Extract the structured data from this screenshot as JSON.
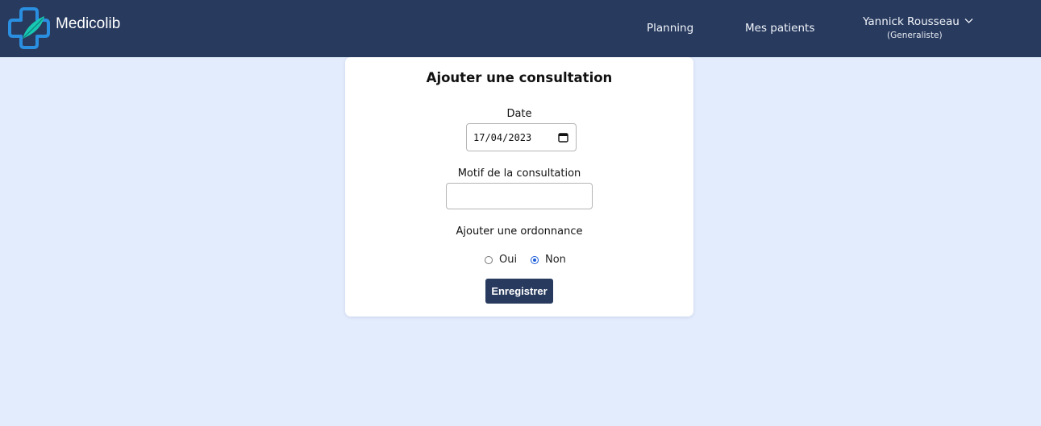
{
  "app": {
    "name": "Medicolib"
  },
  "nav": {
    "planning": "Planning",
    "patients": "Mes patients"
  },
  "user": {
    "name": "Yannick Rousseau",
    "role": "(Generaliste)"
  },
  "form": {
    "title": "Ajouter une consultation",
    "date_label": "Date",
    "date_value": "17/04/2023",
    "motif_label": "Motif de la consultation",
    "motif_value": "",
    "ordonnance_label": "Ajouter une ordonnance",
    "options": [
      {
        "label": "Oui",
        "checked": false
      },
      {
        "label": "Non",
        "checked": true
      }
    ],
    "submit": "Enregistrer"
  },
  "colors": {
    "navbar": "#283a5e",
    "background": "#e3ecfd",
    "logo_blue": "#2a8fe0",
    "logo_teal": "#17c8b3",
    "radio_accent": "#1a5bd8"
  }
}
